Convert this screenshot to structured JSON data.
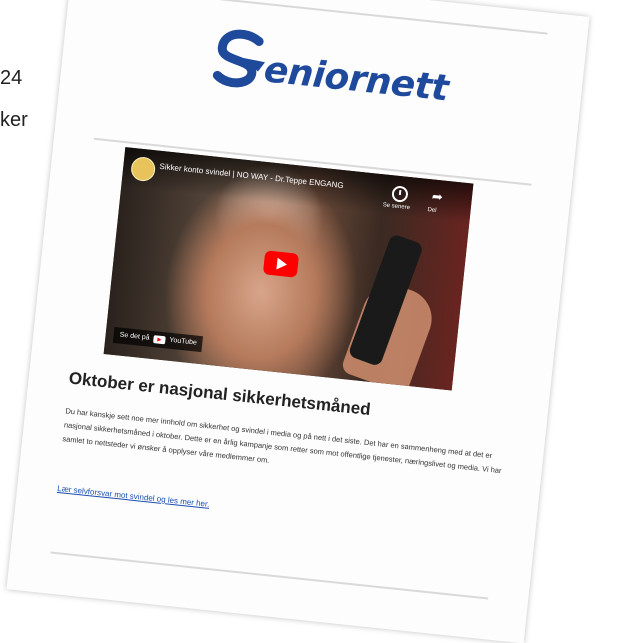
{
  "background": {
    "line1": "24",
    "line2": "ker"
  },
  "brand": {
    "name": "eniornett",
    "color": "#1f4a9c"
  },
  "video": {
    "title": "Sikker konto svindel | NO WAY - Dr.Teppe ENGANG",
    "later_label": "Se senere",
    "share_label": "Del",
    "watch_on": "Se det på",
    "platform": "YouTube",
    "play_color": "#ff0000"
  },
  "article": {
    "headline": "Oktober er nasjonal sikkerhetsmåned",
    "body": "Du har kanskje sett noe mer innhold om sikkerhet og svindel i media og på nett i det siste. Det har en sammenheng med at det er nasjonal sikkerhetsmåned i oktober. Dette er en årlig kampanje som retter som mot offentlige tjenester, næringslivet og media. Vi har samlet to nettsteder vi ønsker å opplyser våre medlemmer om.",
    "link": "Lær selvforsvar mot svindel og les mer her.",
    "link_color": "#1a4fb0"
  }
}
